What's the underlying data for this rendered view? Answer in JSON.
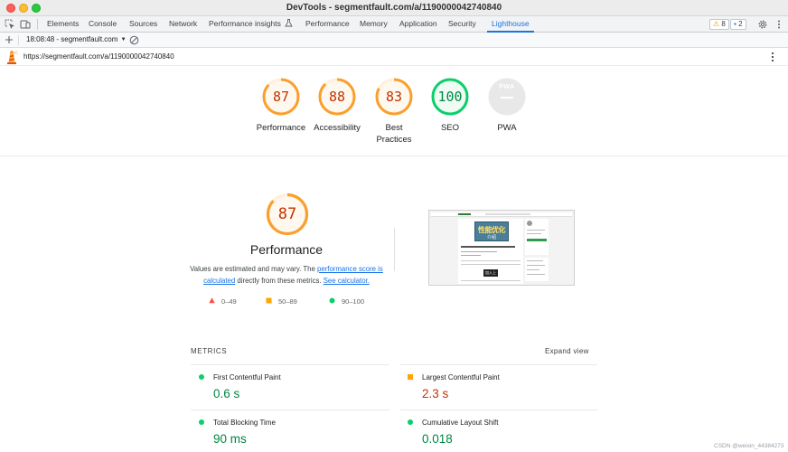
{
  "window": {
    "title": "DevTools - segmentfault.com/a/1190000042740840"
  },
  "tabs": [
    {
      "label": "Elements"
    },
    {
      "label": "Console"
    },
    {
      "label": "Sources"
    },
    {
      "label": "Network"
    },
    {
      "label": "Performance insights"
    },
    {
      "label": "Performance"
    },
    {
      "label": "Memory"
    },
    {
      "label": "Application"
    },
    {
      "label": "Security"
    },
    {
      "label": "Lighthouse",
      "active": true
    }
  ],
  "badges": {
    "warnings": "8",
    "messages": "2"
  },
  "report_toolbar": {
    "selected_report": "18:08:48 - segmentfault.com"
  },
  "url_bar": {
    "url": "https://segmentfault.com/a/1190000042740840"
  },
  "categories": [
    {
      "score": "87",
      "label": "Performance",
      "color": "#fa9f2e",
      "fill": 0.87
    },
    {
      "score": "88",
      "label": "Accessibility",
      "color": "#fa9f2e",
      "fill": 0.88
    },
    {
      "score": "83",
      "label": "Best Practices",
      "color": "#fa9f2e",
      "fill": 0.83
    },
    {
      "score": "100",
      "label": "SEO",
      "color": "#0cce6b",
      "fill": 1.0
    },
    {
      "score": "PWA",
      "label": "PWA",
      "color": "#9aa0a6",
      "fill": 0
    }
  ],
  "performance": {
    "score": "87",
    "title": "Performance",
    "desc_part1": "Values are estimated and may vary. The ",
    "desc_link1": "performance score is calculated",
    "desc_part2": " directly from these metrics. ",
    "desc_link2": "See calculator."
  },
  "legend": [
    {
      "range": "0–49",
      "color": "#ff4e42",
      "shape": "triangle"
    },
    {
      "range": "50–89",
      "color": "#ffa400",
      "shape": "square"
    },
    {
      "range": "90–100",
      "color": "#0cce6b",
      "shape": "circle"
    }
  ],
  "metrics": {
    "heading": "METRICS",
    "expand_label": "Expand view",
    "items": [
      {
        "name": "First Contentful Paint",
        "value": "0.6 s",
        "color": "#018642",
        "shape": "circle"
      },
      {
        "name": "Largest Contentful Paint",
        "value": "2.3 s",
        "color": "#c33300",
        "shape": "square"
      },
      {
        "name": "Total Blocking Time",
        "value": "90 ms",
        "color": "#018642",
        "shape": "circle"
      },
      {
        "name": "Cumulative Layout Shift",
        "value": "0.018",
        "color": "#018642",
        "shape": "circle"
      }
    ]
  },
  "screenshot": {
    "banner_text": "性能优化",
    "banner_sub": "介绍",
    "button_text": "加入上"
  },
  "watermark": "CSDN @weixin_44384273"
}
